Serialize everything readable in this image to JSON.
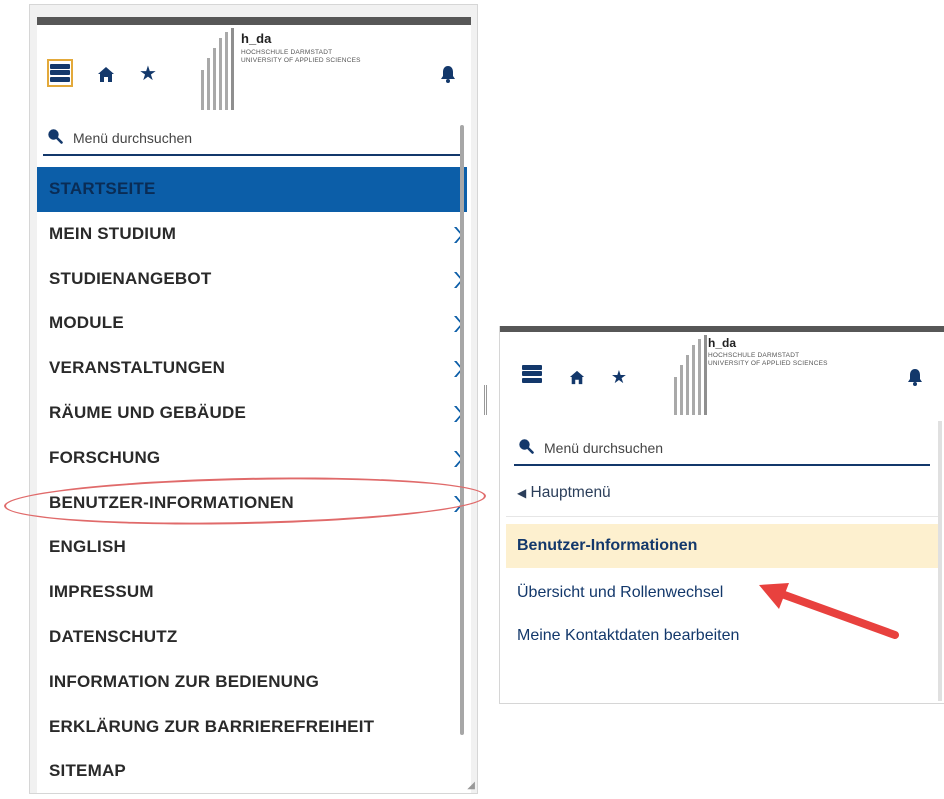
{
  "left_panel": {
    "logo": {
      "title": "h_da",
      "line1": "HOCHSCHULE DARMSTADT",
      "line2": "UNIVERSITY OF APPLIED SCIENCES"
    },
    "search": {
      "placeholder": "Menü durchsuchen"
    },
    "menu": [
      {
        "label": "STARTSEITE",
        "active": true,
        "submenu": false
      },
      {
        "label": "MEIN STUDIUM",
        "submenu": true
      },
      {
        "label": "STUDIENANGEBOT",
        "submenu": true
      },
      {
        "label": "MODULE",
        "submenu": true
      },
      {
        "label": "VERANSTALTUNGEN",
        "submenu": true
      },
      {
        "label": "RÄUME UND GEBÄUDE",
        "submenu": true
      },
      {
        "label": "FORSCHUNG",
        "submenu": true
      },
      {
        "label": "BENUTZER-INFORMATIONEN",
        "submenu": true
      },
      {
        "label": "ENGLISH",
        "submenu": false
      },
      {
        "label": "IMPRESSUM",
        "submenu": false
      },
      {
        "label": "DATENSCHUTZ",
        "submenu": false
      },
      {
        "label": "INFORMATION ZUR BEDIENUNG",
        "submenu": false
      },
      {
        "label": "ERKLÄRUNG ZUR BARRIEREFREIHEIT",
        "submenu": false
      },
      {
        "label": "SITEMAP",
        "submenu": false
      }
    ]
  },
  "right_panel": {
    "logo": {
      "title": "h_da",
      "line1": "HOCHSCHULE DARMSTADT",
      "line2": "UNIVERSITY OF APPLIED SCIENCES"
    },
    "search": {
      "placeholder": "Menü durchsuchen"
    },
    "back_label": "Hauptmenü",
    "section_title": "Benutzer-Informationen",
    "links": [
      {
        "label": "Übersicht und Rollenwechsel"
      },
      {
        "label": "Meine Kontaktdaten bearbeiten"
      }
    ]
  },
  "colors": {
    "brand_blue": "#13386b",
    "active_blue": "#0c5ea8",
    "highlight_yellow": "#fdf0cf",
    "annotation_red": "#e8413e"
  },
  "icons": [
    "hamburger-icon",
    "home-icon",
    "star-icon",
    "bell-icon",
    "search-icon",
    "chevron-right-icon",
    "chevron-left-icon"
  ]
}
